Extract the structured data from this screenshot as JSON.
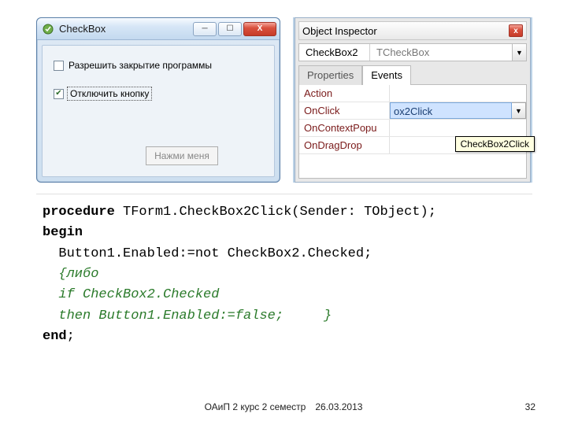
{
  "appWindow": {
    "title": "CheckBox",
    "checkbox1": {
      "label": "Разрешить закрытие программы",
      "checked": false
    },
    "checkbox2": {
      "label": "Отключить кнопку",
      "checked": true
    },
    "button": {
      "label": "Нажми меня"
    }
  },
  "inspector": {
    "title": "Object Inspector",
    "objectName": "CheckBox2",
    "objectType": "TCheckBox",
    "tabs": {
      "properties": "Properties",
      "events": "Events"
    },
    "rows": {
      "action": "Action",
      "onclick": "OnClick",
      "onclick_value": "ox2Click",
      "oncontextpopup": "OnContextPopu",
      "ondragdrop": "OnDragDrop"
    },
    "tooltip": "CheckBox2Click"
  },
  "code": {
    "l1a": "procedure",
    "l1b": " TForm1.CheckBox2Click(Sender: TObject);",
    "l2": "begin",
    "l3": "  Button1.Enabled:=not CheckBox2.Checked;",
    "l4": "  {либо",
    "l5": "  if CheckBox2.Checked",
    "l6": "  then Button1.Enabled:=false;     }",
    "l7a": "end",
    "l7b": ";"
  },
  "footer": {
    "course": "ОАиП 2 курс 2 семестр",
    "date": "26.03.2013",
    "page": "32"
  }
}
